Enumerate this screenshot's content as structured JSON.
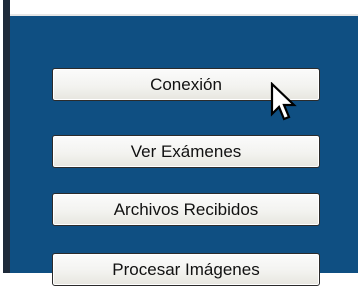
{
  "buttons": [
    {
      "label": "Conexión"
    },
    {
      "label": "Ver Exámenes"
    },
    {
      "label": "Archivos Recibidos"
    },
    {
      "label": "Procesar Imágenes"
    }
  ],
  "colors": {
    "panel_background": "#0f4f82",
    "button_text": "#111111"
  },
  "cursor": {
    "icon": "arrow-cursor-icon"
  }
}
